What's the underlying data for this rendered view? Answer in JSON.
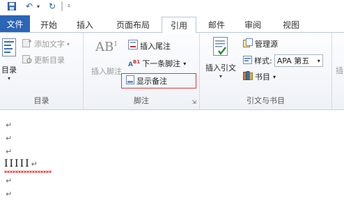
{
  "qat": {
    "save_icon": "save-icon",
    "undo_icon": "undo-icon",
    "redo_icon": "redo-icon"
  },
  "tabs": [
    {
      "label": "文件"
    },
    {
      "label": "开始"
    },
    {
      "label": "插入"
    },
    {
      "label": "页面布局"
    },
    {
      "label": "引用"
    },
    {
      "label": "邮件"
    },
    {
      "label": "审阅"
    },
    {
      "label": "视图"
    }
  ],
  "ribbon": {
    "toc_group": {
      "label": "目录",
      "toc_button": "目录",
      "add_text": "添加文字",
      "update_toc": "更新目录"
    },
    "footnote_group": {
      "label": "脚注",
      "insert_footnote": "插入脚注",
      "insert_endnote": "插入尾注",
      "next_footnote": "下一条脚注",
      "show_notes": "显示备注",
      "ab_glyph": "AB",
      "sup_glyph": "1"
    },
    "citation_group": {
      "label": "引文与书目",
      "insert_citation": "插入引文",
      "manage_sources": "管理源",
      "style_label": "样式:",
      "style_value": "APA 第五",
      "bibliography": "书目"
    },
    "next_group": {
      "label": "插"
    }
  },
  "document": {
    "para_mark": "↵",
    "text_line": "IIIII"
  },
  "colors": {
    "file_tab": "#2b65b8",
    "highlight_border": "#e03a3a",
    "spell_squiggle": "#e23b3b"
  }
}
